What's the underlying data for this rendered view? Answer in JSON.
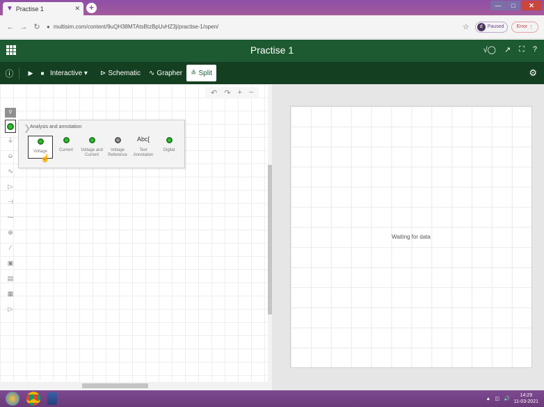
{
  "browser": {
    "tab_title": "Practise 1",
    "url": "multisim.com/content/9uQH38MTAtsBtzBpUvHZ3j/practise-1/open/",
    "profile_initial": "d",
    "paused_label": "Paused",
    "error_label": "Error"
  },
  "app": {
    "title": "Practise 1"
  },
  "toolbar": {
    "mode_label": "Interactive",
    "schematic_label": "Schematic",
    "grapher_label": "Grapher",
    "split_label": "Split"
  },
  "flyout": {
    "title": "Analysis and annotation",
    "items": [
      {
        "line1": "Voltage",
        "line2": "",
        "icon": "voltage-probe-icon"
      },
      {
        "line1": "Current",
        "line2": "",
        "icon": "current-probe-icon"
      },
      {
        "line1": "Voltage and",
        "line2": "Current",
        "icon": "voltage-current-probe-icon"
      },
      {
        "line1": "Voltage",
        "line2": "Reference",
        "icon": "voltage-reference-icon"
      },
      {
        "line1": "Text",
        "line2": "Annotation",
        "icon": "text-annotation-icon",
        "glyph": "Abc["
      },
      {
        "line1": "Digital",
        "line2": "",
        "icon": "digital-probe-icon"
      }
    ]
  },
  "grapher": {
    "waiting_text": "Waiting for data"
  },
  "taskbar": {
    "time": "14:29",
    "date": "11-03-2021"
  },
  "colors": {
    "header_green": "#1d5a31",
    "toolbar_green": "#143f21",
    "probe_green": "#2ec22e",
    "browser_purple": "#8e4fa6"
  }
}
